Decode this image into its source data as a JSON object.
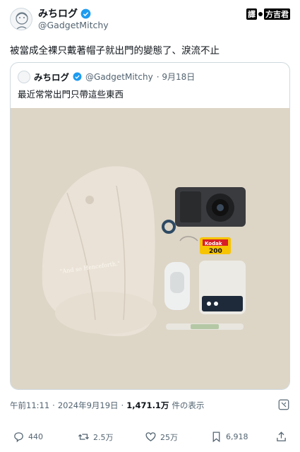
{
  "author": {
    "name": "みちログ",
    "handle": "@GadgetMitchy"
  },
  "watermark": {
    "left": "譯",
    "right": "方吉君"
  },
  "tweet": {
    "text": "被當成全裸只戴著帽子就出門的變態了、淚流不止"
  },
  "quote": {
    "name": "みちログ",
    "handle": "@GadgetMitchy",
    "date": "· 9月18日",
    "text": "最近常常出門只帶這些東西",
    "photo": {
      "cap_text": "\"And so Henceforth.\"",
      "film_brand": "Kodak",
      "film_speed": "200"
    }
  },
  "meta": {
    "time": "午前11:11",
    "sep": "·",
    "date": "2024年9月19日",
    "sep2": "·",
    "views": "1,471.1万",
    "views_label": "件の表示"
  },
  "actions": {
    "replies": "440",
    "reposts": "2.5万",
    "likes": "25万",
    "bookmarks": "6,918"
  },
  "colors": {
    "verified": "#1d9bf0",
    "text_secondary": "#536471",
    "photo_bg": "#ddd5c6"
  }
}
